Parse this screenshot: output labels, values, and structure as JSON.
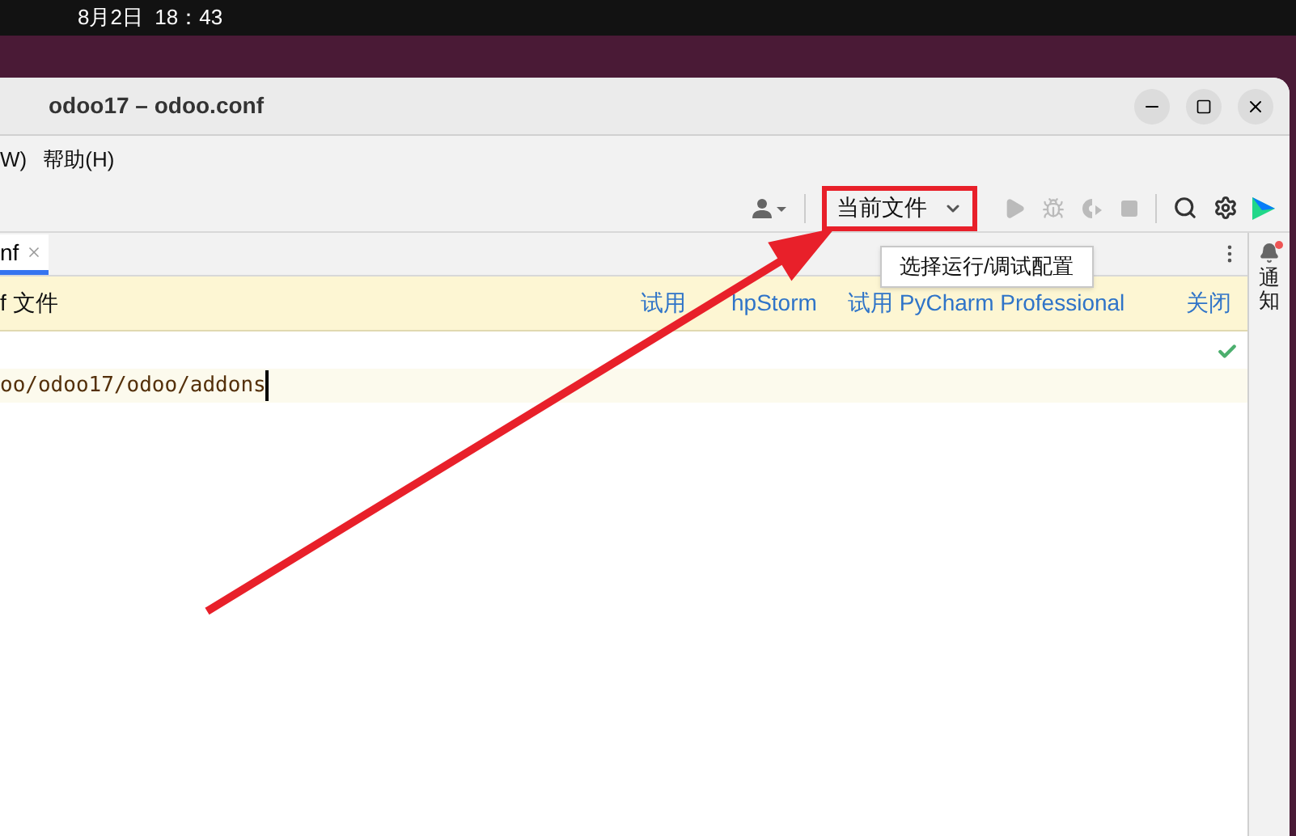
{
  "top_bar": {
    "clock": "8月2日  18：43"
  },
  "window": {
    "title": "odoo17 – odoo.conf"
  },
  "menu": [
    {
      "label": "W)"
    },
    {
      "label": "帮助(H)"
    }
  ],
  "toolbar": {
    "run_config": "当前文件",
    "tooltip": "选择运行/调试配置"
  },
  "tabs": [
    {
      "label": "nf",
      "selected": true
    }
  ],
  "banner": {
    "text": "f 文件",
    "links": [
      "试用",
      "hpStorm",
      "试用 PyCharm Professional",
      "关闭"
    ]
  },
  "editor": {
    "lines": [
      {
        "highlighted": false
      },
      {
        "text": "oo/odoo17/odoo/addons",
        "highlighted": true
      }
    ]
  },
  "side_panel": {
    "label": "通知",
    "has_notification": true
  }
}
